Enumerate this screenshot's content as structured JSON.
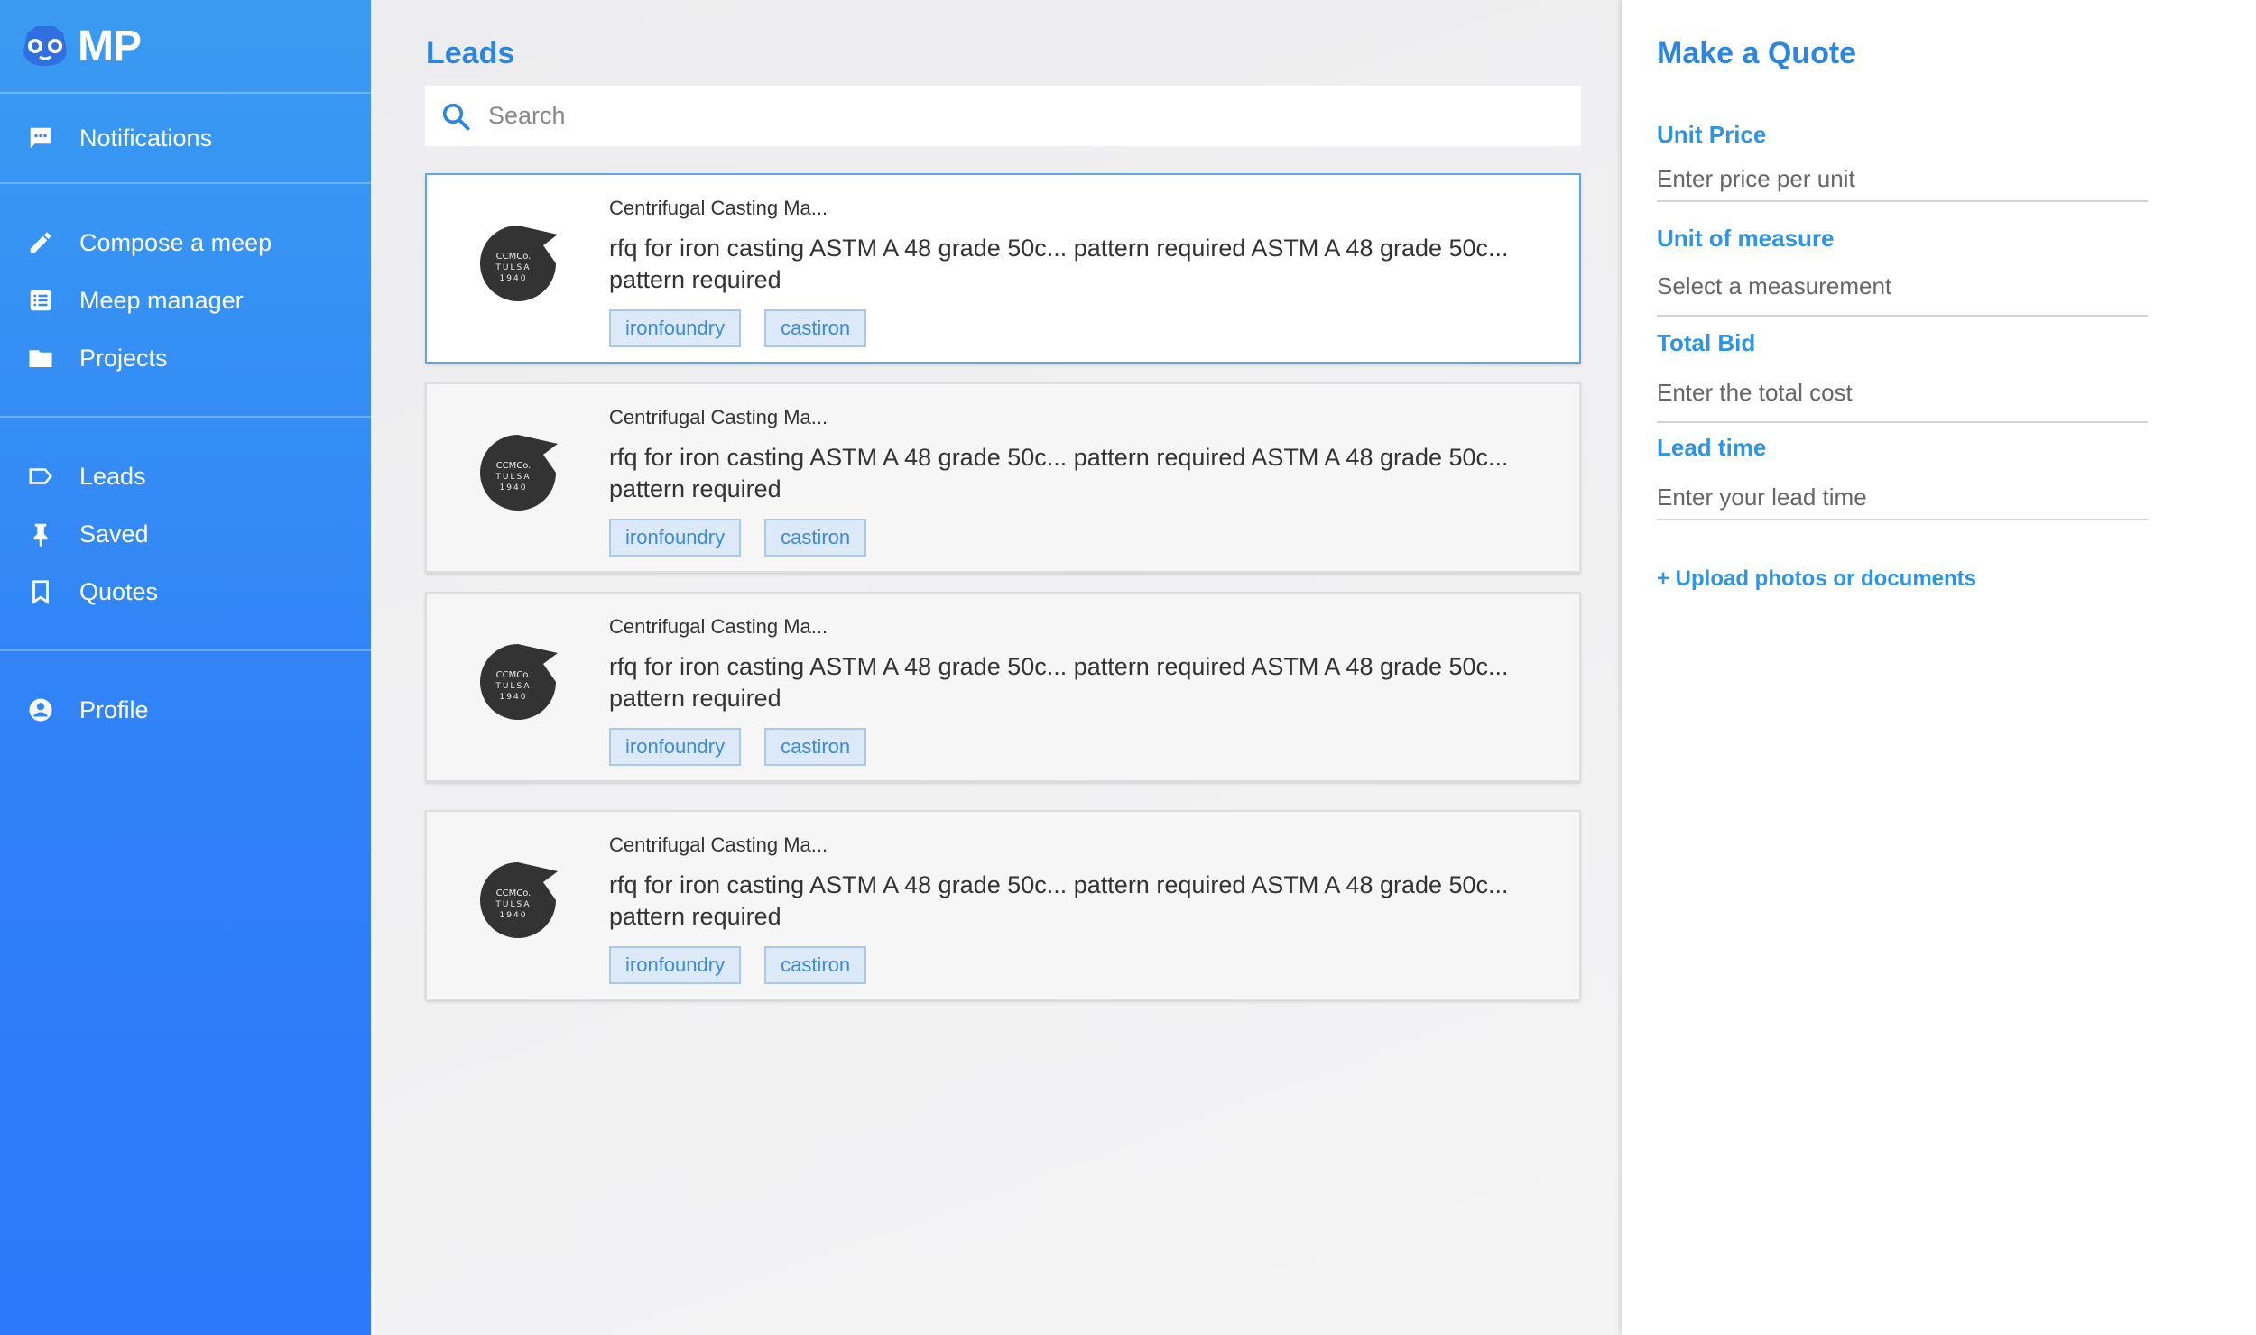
{
  "app": {
    "logo_text": "MP",
    "brand_color": "#3080f8",
    "accent_color": "#2a86e0"
  },
  "sidebar": {
    "items": [
      {
        "label": "Notifications",
        "icon": "chat-bubble-icon"
      },
      {
        "label": "Compose a meep",
        "icon": "pencil-icon"
      },
      {
        "label": "Meep manager",
        "icon": "list-icon"
      },
      {
        "label": "Projects",
        "icon": "folder-icon"
      },
      {
        "label": "Leads",
        "icon": "tag-icon"
      },
      {
        "label": "Saved",
        "icon": "pin-icon"
      },
      {
        "label": "Quotes",
        "icon": "bookmark-icon"
      },
      {
        "label": "Profile",
        "icon": "account-circle-icon"
      }
    ]
  },
  "main": {
    "title": "Leads",
    "search": {
      "placeholder": "Search",
      "value": ""
    },
    "leads": [
      {
        "company": "Centrifugal Casting Ma...",
        "description": "rfq for iron casting ASTM A 48 grade 50c... pattern required  ASTM A 48 grade 50c... pattern required",
        "tags": [
          "ironfoundry",
          "castiron"
        ],
        "logo_lines": [
          "CCMCo.",
          "TULSA",
          "1940"
        ],
        "selected": true
      },
      {
        "company": "Centrifugal Casting Ma...",
        "description": "rfq for iron casting ASTM A 48 grade 50c... pattern required  ASTM A 48 grade 50c... pattern required",
        "tags": [
          "ironfoundry",
          "castiron"
        ],
        "logo_lines": [
          "CCMCo.",
          "TULSA",
          "1940"
        ],
        "selected": false
      },
      {
        "company": "Centrifugal Casting Ma...",
        "description": "rfq for iron casting ASTM A 48 grade 50c... pattern required  ASTM A 48 grade 50c... pattern required",
        "tags": [
          "ironfoundry",
          "castiron"
        ],
        "logo_lines": [
          "CCMCo.",
          "TULSA",
          "1940"
        ],
        "selected": false
      },
      {
        "company": "Centrifugal Casting Ma...",
        "description": "rfq for iron casting ASTM A 48 grade 50c... pattern required  ASTM A 48 grade 50c... pattern required",
        "tags": [
          "ironfoundry",
          "castiron"
        ],
        "logo_lines": [
          "CCMCo.",
          "TULSA",
          "1940"
        ],
        "selected": false
      }
    ]
  },
  "quote": {
    "title": "Make a Quote",
    "fields": [
      {
        "label": "Unit Price",
        "placeholder": "Enter price per unit",
        "value": ""
      },
      {
        "label": "Unit of measure",
        "placeholder": "Select a measurement",
        "value": ""
      },
      {
        "label": "Total Bid",
        "placeholder": "Enter the total cost",
        "value": ""
      },
      {
        "label": "Lead time",
        "placeholder": "Enter your lead time",
        "value": ""
      }
    ],
    "upload_label": "+ Upload photos or documents"
  }
}
